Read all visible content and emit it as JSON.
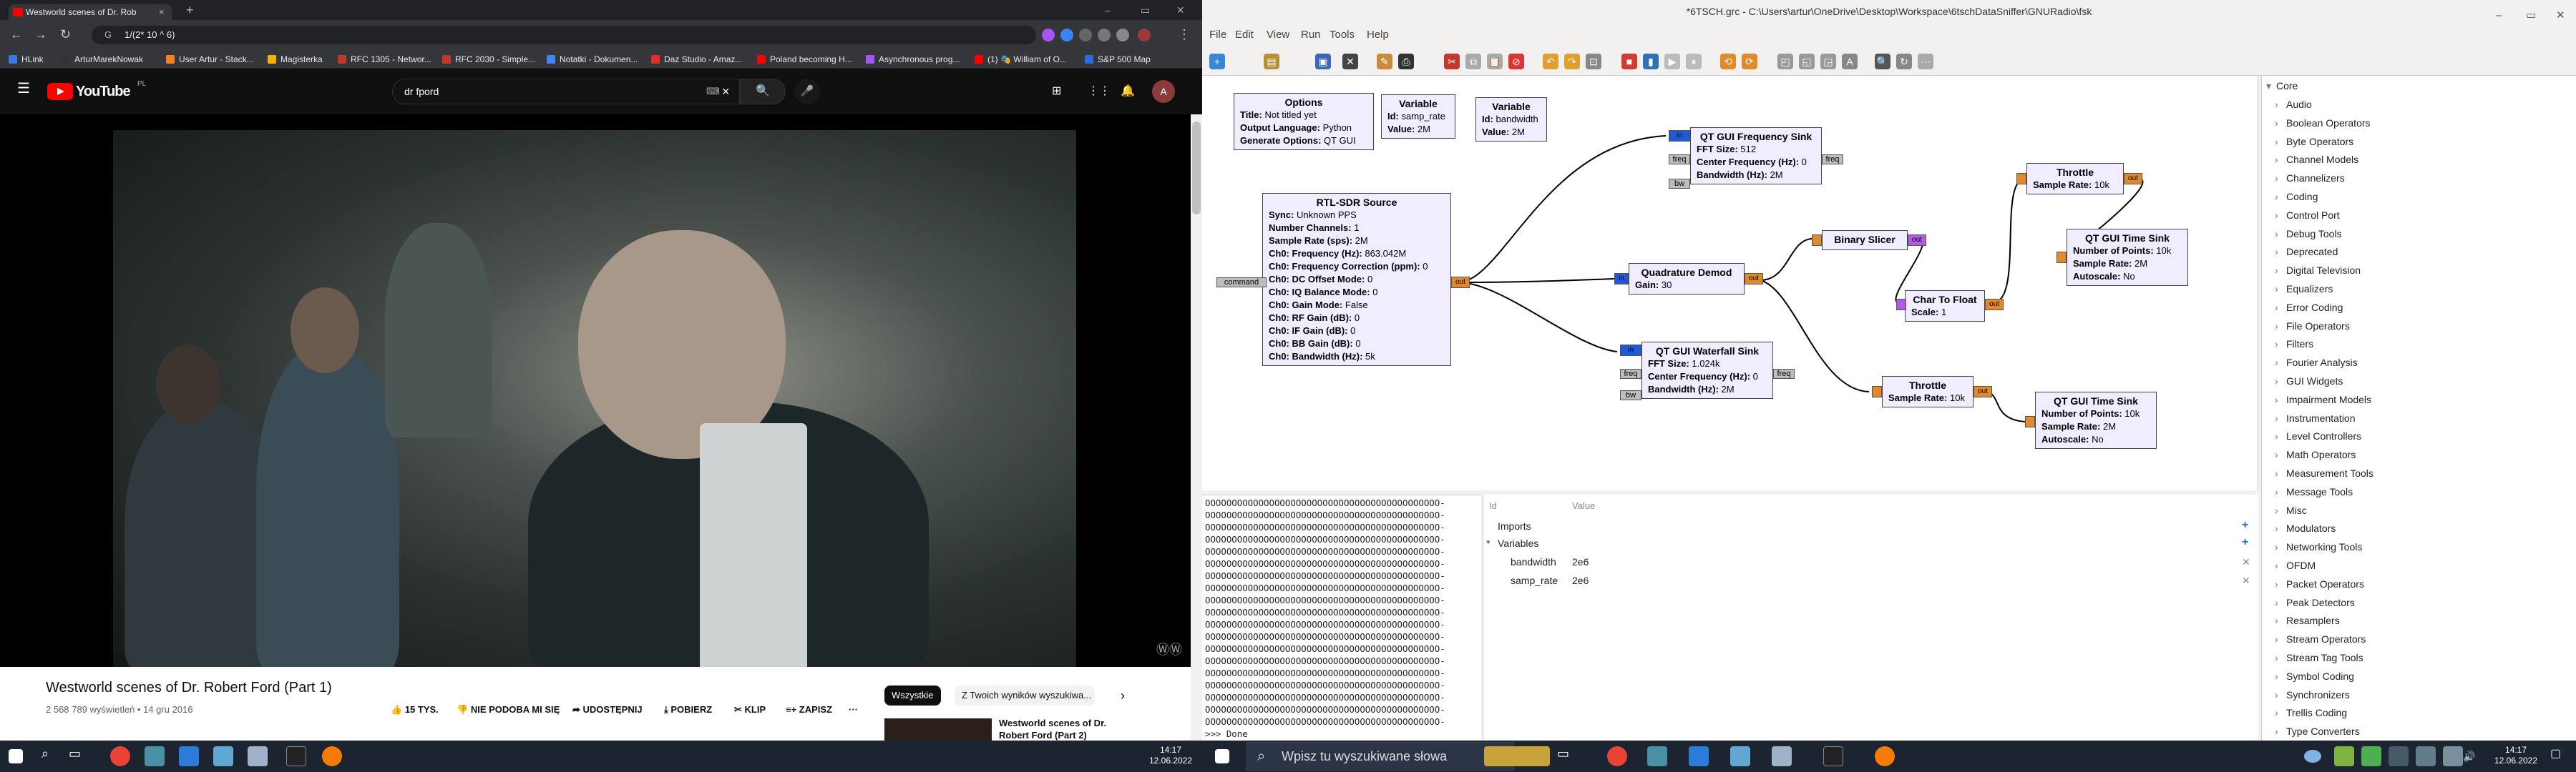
{
  "chrome": {
    "tab_title": "Westworld scenes of Dr. Rob",
    "tab_close": "×",
    "new_tab": "+",
    "window_controls": [
      "–",
      "▭",
      "✕"
    ],
    "omnibox_text": "1/(2* 10 ^ 6)",
    "bookmarks": [
      {
        "label": "HLink",
        "color": "#3a7be0"
      },
      {
        "label": "ArturMarekNowak",
        "color": "#333333"
      },
      {
        "label": "User Artur - Stack...",
        "color": "#f48024"
      },
      {
        "label": "Magisterka",
        "color": "#f4b400"
      },
      {
        "label": "RFC 1305 - Networ...",
        "color": "#c0392b"
      },
      {
        "label": "RFC 2030 - Simple...",
        "color": "#c0392b"
      },
      {
        "label": "Notatki - Dokumen...",
        "color": "#4285f4"
      },
      {
        "label": "Daz Studio - Amaz...",
        "color": "#e52d27"
      },
      {
        "label": "Poland becoming H...",
        "color": "#ff0000"
      },
      {
        "label": "Asynchronous prog...",
        "color": "#a855f7"
      },
      {
        "label": "(1) 🎭 William of O...",
        "color": "#ff0000"
      },
      {
        "label": "S&P 500 Map",
        "color": "#2d6cdf"
      }
    ]
  },
  "youtube": {
    "logo": "YouTube",
    "region": "PL",
    "search_value": "dr fpord",
    "search_clear": "×",
    "video_title": "Westworld scenes of Dr. Robert Ford (Part 1)",
    "views": "2 568 789 wyświetleń",
    "date": "14 gru 2016",
    "actions": {
      "likes": "15 TYS.",
      "dislike": "NIE PODOBA MI SIĘ",
      "share": "UDOSTĘPNIJ",
      "download": "POBIERZ",
      "clip": "KLIP",
      "save": "ZAPISZ",
      "more": "···"
    },
    "chips": [
      "Wszystkie",
      "Z Twoich wyników wyszukiwa..."
    ],
    "next_chip": "›",
    "side_video_title": "Westworld scenes of Dr. Robert Ford (Part 2)",
    "watermark": "ⓌⓌ"
  },
  "grc": {
    "window_title": "*6TSCH.grc - C:\\Users\\artur\\OneDrive\\Desktop\\Workspace\\6tschDataSniffer\\GNURadio\\fsk",
    "menu": [
      "File",
      "Edit",
      "View",
      "Run",
      "Tools",
      "Help"
    ],
    "blocks": {
      "options": {
        "title": "Options",
        "lines": [
          [
            "Title:",
            "Not titled yet"
          ],
          [
            "Output Language:",
            "Python"
          ],
          [
            "Generate Options:",
            "QT GUI"
          ]
        ]
      },
      "var_samp": {
        "title": "Variable",
        "lines": [
          [
            "Id:",
            "samp_rate"
          ],
          [
            "Value:",
            "2M"
          ]
        ]
      },
      "var_bw": {
        "title": "Variable",
        "lines": [
          [
            "Id:",
            "bandwidth"
          ],
          [
            "Value:",
            "2M"
          ]
        ]
      },
      "rtl": {
        "title": "RTL-SDR Source",
        "lines": [
          [
            "Sync:",
            "Unknown PPS"
          ],
          [
            "Number Channels:",
            "1"
          ],
          [
            "Sample Rate (sps):",
            "2M"
          ],
          [
            "Ch0: Frequency (Hz):",
            "863.042M"
          ],
          [
            "Ch0: Frequency Correction (ppm):",
            "0"
          ],
          [
            "Ch0: DC Offset Mode:",
            "0"
          ],
          [
            "Ch0: IQ Balance Mode:",
            "0"
          ],
          [
            "Ch0: Gain Mode:",
            "False"
          ],
          [
            "Ch0: RF Gain (dB):",
            "0"
          ],
          [
            "Ch0: IF Gain (dB):",
            "0"
          ],
          [
            "Ch0: BB Gain (dB):",
            "0"
          ],
          [
            "Ch0: Bandwidth (Hz):",
            "5k"
          ]
        ]
      },
      "freq_sink": {
        "title": "QT GUI Frequency Sink",
        "lines": [
          [
            "FFT Size:",
            "512"
          ],
          [
            "Center Frequency (Hz):",
            "0"
          ],
          [
            "Bandwidth (Hz):",
            "2M"
          ]
        ]
      },
      "waterfall": {
        "title": "QT GUI Waterfall Sink",
        "lines": [
          [
            "FFT Size:",
            "1.024k"
          ],
          [
            "Center Frequency (Hz):",
            "0"
          ],
          [
            "Bandwidth (Hz):",
            "2M"
          ]
        ]
      },
      "quad": {
        "title": "Quadrature Demod",
        "lines": [
          [
            "Gain:",
            "30"
          ]
        ]
      },
      "slicer": {
        "title": "Binary Slicer",
        "lines": []
      },
      "c2f": {
        "title": "Char To Float",
        "lines": [
          [
            "Scale:",
            "1"
          ]
        ]
      },
      "thr1": {
        "title": "Throttle",
        "lines": [
          [
            "Sample Rate:",
            "10k"
          ]
        ]
      },
      "thr2": {
        "title": "Throttle",
        "lines": [
          [
            "Sample Rate:",
            "10k"
          ]
        ]
      },
      "time1": {
        "title": "QT GUI Time Sink",
        "lines": [
          [
            "Number of Points:",
            "10k"
          ],
          [
            "Sample Rate:",
            "2M"
          ],
          [
            "Autoscale:",
            "No"
          ]
        ]
      },
      "time2": {
        "title": "QT GUI Time Sink",
        "lines": [
          [
            "Number of Points:",
            "10k"
          ],
          [
            "Sample Rate:",
            "2M"
          ],
          [
            "Autoscale:",
            "No"
          ]
        ]
      }
    },
    "port_labels": {
      "in": "in",
      "out": "out",
      "freq": "freq",
      "bw": "bw",
      "command": "command"
    },
    "console_line": "OOOOOOOOOOOOOOOOOOOOOOOOOOOOOOOOOOOOOOOOOOOO-",
    "console_done": ">>> Done",
    "vars_headers": [
      "Id",
      "Value"
    ],
    "vars_groups": [
      "Imports",
      "Variables"
    ],
    "vars_rows": [
      {
        "id": "bandwidth",
        "value": "2e6"
      },
      {
        "id": "samp_rate",
        "value": "2e6"
      }
    ],
    "tree_root": "Core",
    "tree_items": [
      "Audio",
      "Boolean Operators",
      "Byte Operators",
      "Channel Models",
      "Channelizers",
      "Coding",
      "Control Port",
      "Debug Tools",
      "Deprecated",
      "Digital Television",
      "Equalizers",
      "Error Coding",
      "File Operators",
      "Filters",
      "Fourier Analysis",
      "GUI Widgets",
      "Impairment Models",
      "Instrumentation",
      "Level Controllers",
      "Math Operators",
      "Measurement Tools",
      "Message Tools",
      "Misc",
      "Modulators",
      "Networking Tools",
      "OFDM",
      "Packet Operators",
      "Peak Detectors",
      "Resamplers",
      "Stream Operators",
      "Stream Tag Tools",
      "Symbol Coding",
      "Synchronizers",
      "Trellis Coding",
      "Type Converters"
    ]
  },
  "taskbar": {
    "search_placeholder": "Wpisz tu wyszukiwane słowa",
    "left_time": "14:17",
    "left_date": "12.06.2022",
    "right_time": "14:17",
    "right_date": "12.06.2022"
  }
}
